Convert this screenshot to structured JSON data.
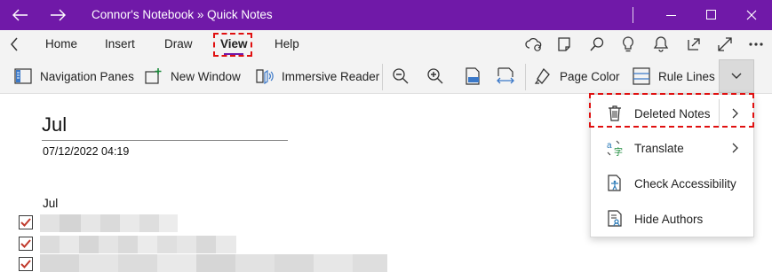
{
  "titlebar": {
    "title": "Connor's Notebook » Quick Notes",
    "back_icon": "arrow-left-icon",
    "forward_icon": "arrow-right-icon",
    "color": "#7019a8"
  },
  "menu": {
    "back_icon": "chevron-left-icon",
    "items": [
      "Home",
      "Insert",
      "Draw",
      "View",
      "Help"
    ],
    "active": "View",
    "right_icons": [
      "sync-icon",
      "page-icon",
      "search-icon",
      "lightbulb-icon",
      "bell-icon",
      "share-icon",
      "expand-icon",
      "more-icon"
    ]
  },
  "ribbon": {
    "navigation_panes": "Navigation Panes",
    "new_window": "New Window",
    "immersive_reader": "Immersive Reader",
    "zoom_icons": [
      "zoom-out-icon",
      "zoom-in-icon",
      "zoom-100-icon",
      "page-width-icon"
    ],
    "page_color": "Page Color",
    "rule_lines": "Rule Lines"
  },
  "page": {
    "title": "Jul",
    "date": "07/12/2022 04:19",
    "heading": "Jul",
    "todo_checked": [
      true,
      true,
      true
    ]
  },
  "dropdown": {
    "items": [
      {
        "label": "Deleted Notes",
        "icon": "trash-icon",
        "submenu": true
      },
      {
        "label": "Translate",
        "icon": "translate-icon",
        "submenu": true
      },
      {
        "label": "Check Accessibility",
        "icon": "accessibility-icon",
        "submenu": false
      },
      {
        "label": "Hide Authors",
        "icon": "hide-authors-icon",
        "submenu": false
      }
    ]
  },
  "colors": {
    "highlight": "#e01010",
    "checkmark": "#c0392b"
  }
}
